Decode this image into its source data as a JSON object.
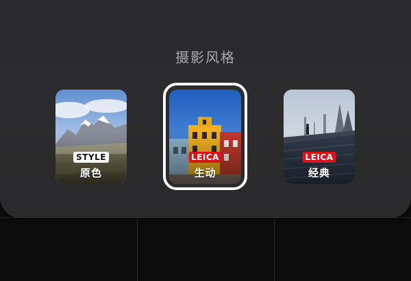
{
  "panel": {
    "title": "摄影风格"
  },
  "styles": [
    {
      "badge": "STYLE",
      "label": "原色",
      "selected": false,
      "badge_color": "#ffffff"
    },
    {
      "badge": "LEICA",
      "label": "生动",
      "selected": true,
      "badge_color": "#d8131b"
    },
    {
      "badge": "LEICA",
      "label": "经典",
      "selected": false,
      "badge_color": "#d8131b"
    }
  ],
  "colors": {
    "sheet_bg": "#2b2b2d",
    "title_text": "#a9a9ac",
    "selection_ring": "#ffffff",
    "leica_red": "#d8131b"
  }
}
